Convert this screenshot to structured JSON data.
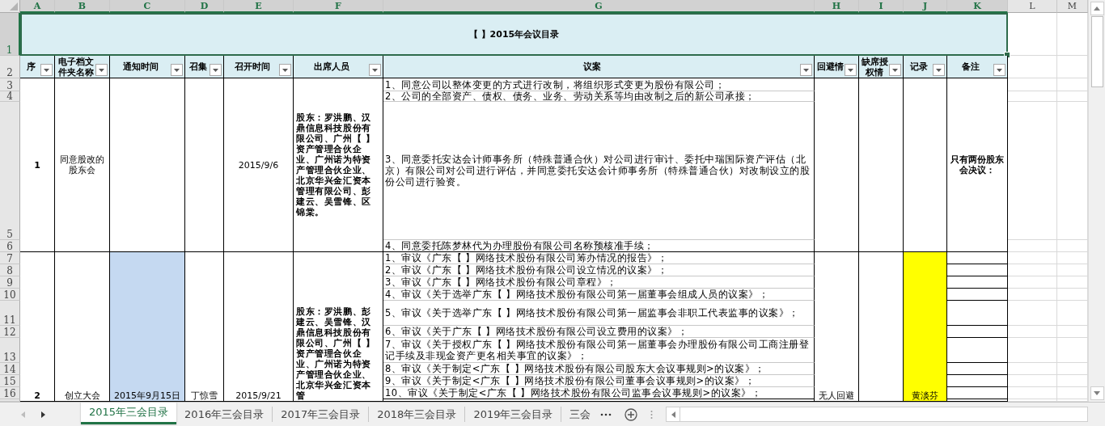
{
  "columns": [
    {
      "label": "A",
      "selected": true
    },
    {
      "label": "B",
      "selected": true
    },
    {
      "label": "C",
      "selected": true
    },
    {
      "label": "D",
      "selected": true
    },
    {
      "label": "E",
      "selected": true
    },
    {
      "label": "F",
      "selected": true
    },
    {
      "label": "G",
      "selected": true
    },
    {
      "label": "H",
      "selected": true
    },
    {
      "label": "I",
      "selected": true
    },
    {
      "label": "J",
      "selected": true
    },
    {
      "label": "K",
      "selected": true
    },
    {
      "label": "L",
      "selected": false
    },
    {
      "label": "M",
      "selected": false
    }
  ],
  "row_numbers": [
    {
      "label": "1",
      "selected": true
    },
    {
      "label": "2",
      "selected": false
    },
    {
      "label": "3",
      "selected": false
    },
    {
      "label": "4",
      "selected": false
    },
    {
      "label": "5",
      "selected": false
    },
    {
      "label": "6",
      "selected": false
    },
    {
      "label": "7",
      "selected": false
    },
    {
      "label": "8",
      "selected": false
    },
    {
      "label": "9",
      "selected": false
    },
    {
      "label": "10",
      "selected": false
    },
    {
      "label": "11",
      "selected": false
    },
    {
      "label": "12",
      "selected": false
    },
    {
      "label": "13",
      "selected": false
    },
    {
      "label": "14",
      "selected": false
    },
    {
      "label": "15",
      "selected": false
    },
    {
      "label": "16",
      "selected": false
    }
  ],
  "title": "【 】2015年会议目录",
  "header_cells": [
    "序",
    "电子档文件夹名称",
    "通知时间",
    "召集",
    "召开时间",
    "出席人员",
    "议案",
    "回避情",
    "缺席授权情",
    "记录",
    "备注"
  ],
  "meetings": [
    {
      "no": "1",
      "folder": "同意股改的股东会",
      "date": "2015/9/6",
      "attendees": "股东：罗洪鹏、汉鼎信息科技股份有限公司、广州【 】资产管理合伙企业、广州诺为特资产管理合伙企业、北京华兴金汇资本管理有限公司、彭建云、吴雪锋、区锦棠。",
      "agenda": [
        "1、同意公司以整体变更的方式进行改制，将组织形式变更为股份有限公司；",
        "2、公司的全部资产、债权、债务、业务、劳动关系等均由改制之后的新公司承接；",
        "3、同意委托安达会计师事务所（特殊普通合伙）对公司进行审计、委托中瑞国际资产评估（北京）有限公司对公司进行评估，并同意委托安达会计师事务所（特殊普通合伙）对改制设立的股份公司进行验资。",
        "4、同意委托陈梦林代为办理股份有限公司名称预核准手续；"
      ],
      "remark": "只有两份股东会决议："
    },
    {
      "no": "2",
      "folder": "创立大会",
      "notice": {
        "text": "2015年9月15日",
        "color": "#c5d9f1"
      },
      "convener": "丁惊雪",
      "date": "2015/9/21",
      "attendees": "股东：罗洪鹏、彭建云、吴雪锋、汉鼎信息科技股份有限公司、广州【 】资产管理合伙企业、广州诺为特资产管理合伙企业、北京华兴金汇资本管",
      "agenda": [
        "1、审议《广东【 】网络技术股份有限公司筹办情况的报告》；",
        "2、审议《广东【 】网络技术股份有限公司设立情况的议案》；",
        "3、审议《广东【 】网络技术股份有限公司章程》；",
        "4、审议《关于选举广东【 】网络技术股份有限公司第一届董事会组成人员的议案》；",
        "5、审议《关于选举广东【 】网络技术股份有限公司第一届监事会非职工代表监事的议案》；",
        "6、审议《关于广东【 】网络技术股份有限公司设立费用的议案》；",
        "7、审议《关于授权广东【 】网络技术股份有限公司第一届董事会办理股份有限公司工商注册登记手续及非现金资产更名相关事宜的议案》；",
        "8、审议《关于制定<广东【 】网络技术股份有限公司股东大会议事规则>的议案》；",
        "9、审议《关于制定<广东【 】网络技术股份有限公司董事会议事规则>的议案》；",
        "10、审议《关于制定<广东【 】网络技术股份有限公司监事会议事规则>的议案》；"
      ],
      "avoidance": "无人回避",
      "recorder": {
        "text": "黄淡芬",
        "color": "#ffff00"
      }
    }
  ],
  "sheet_tabs": [
    {
      "label": "2015年三会目录",
      "selected": true
    },
    {
      "label": "2016年三会目录",
      "selected": false
    },
    {
      "label": "2017年三会目录",
      "selected": false
    },
    {
      "label": "2018年三会目录",
      "selected": false
    },
    {
      "label": "2019年三会目录",
      "selected": false
    },
    {
      "label": "三会",
      "selected": false
    }
  ]
}
